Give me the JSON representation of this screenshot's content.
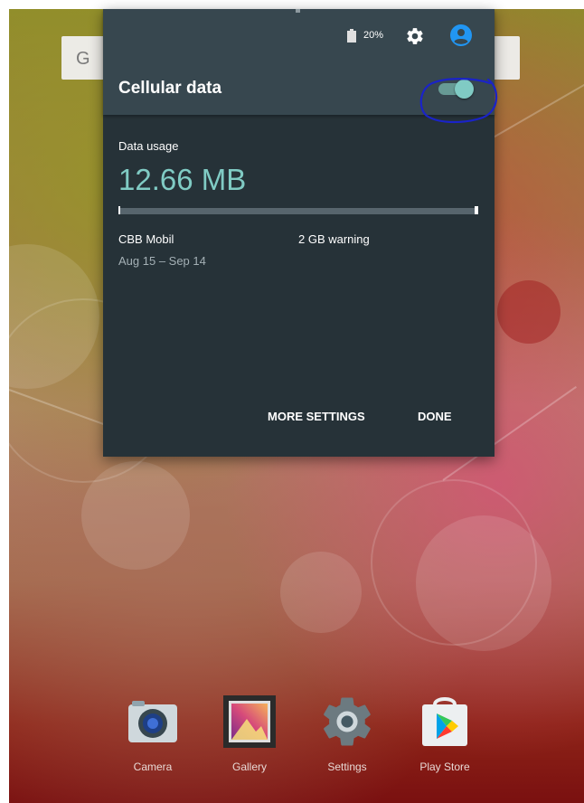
{
  "status_bar": {
    "battery_text": "20%",
    "icons": [
      "battery-icon",
      "gear-icon",
      "account-icon"
    ]
  },
  "search_bar": {
    "visible_letter": "G"
  },
  "cellular": {
    "title": "Cellular data",
    "toggle_on": true,
    "accent_color": "#80cbc4"
  },
  "usage": {
    "label": "Data usage",
    "value": "12.66 MB",
    "carrier": "CBB Mobil",
    "date_range": "Aug 15 – Sep 14",
    "warning": "2 GB warning",
    "bar_fraction": 0.006
  },
  "actions": {
    "more_settings": "MORE SETTINGS",
    "done": "DONE"
  },
  "dock": {
    "apps": [
      {
        "label": "Camera",
        "icon": "camera-icon"
      },
      {
        "label": "Gallery",
        "icon": "gallery-icon"
      },
      {
        "label": "Settings",
        "icon": "settings-icon"
      },
      {
        "label": "Play Store",
        "icon": "play-store-icon"
      }
    ]
  },
  "colors": {
    "panel_bg": "#263238",
    "panel_header": "#37474f",
    "account_blue": "#2196f3",
    "annotation_circle": "#1a23c8"
  }
}
